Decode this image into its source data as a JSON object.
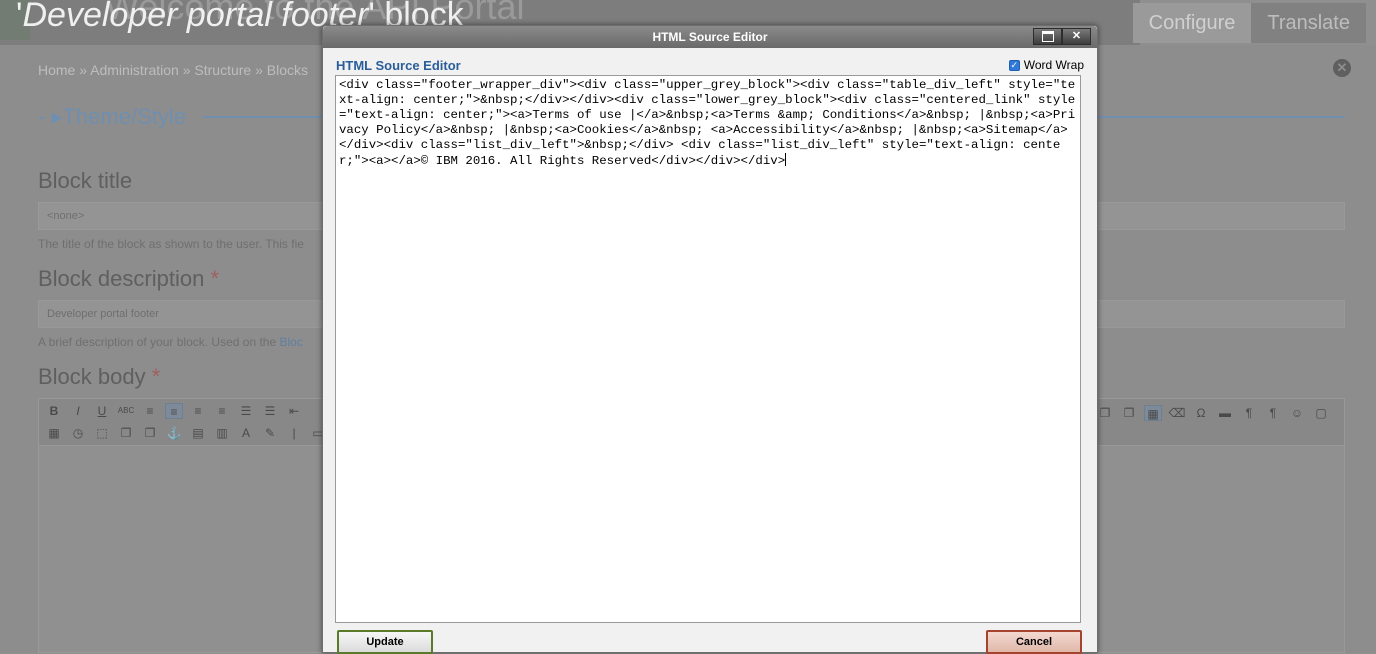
{
  "page": {
    "ghost_title": "Welcome to the API Portal",
    "title_quoted": "Developer portal footer",
    "title_suffix": " block",
    "tabs": [
      "Configure",
      "Translate"
    ],
    "breadcrumb": "Home » Administration » Structure » Blocks",
    "theme_legend": "- ▸Theme/Style",
    "block_title_label": "Block title",
    "block_title_value": "<none>",
    "block_title_help": "The title of the block as shown to the user. This fie",
    "block_desc_label": "Block description",
    "block_desc_value": "Developer portal footer",
    "block_desc_help": "A brief description of your block. Used on the ",
    "block_desc_help_link": "Bloc",
    "block_body_label": "Block body",
    "required_mark": "*"
  },
  "dialog": {
    "title": "HTML Source Editor",
    "heading": "HTML Source Editor",
    "word_wrap_label": "Word Wrap",
    "word_wrap_checked": true,
    "source": "<div class=\"footer_wrapper_div\"><div class=\"upper_grey_block\"><div class=\"table_div_left\" style=\"text-align: center;\">&nbsp;</div></div><div class=\"lower_grey_block\"><div class=\"centered_link\" style=\"text-align: center;\"><a>Terms of use |</a>&nbsp;<a>Terms &amp; Conditions</a>&nbsp; |&nbsp;<a>Privacy Policy</a>&nbsp; |&nbsp;<a>Cookies</a>&nbsp; <a>Accessibility</a>&nbsp; |&nbsp;<a>Sitemap</a></div><div class=\"list_div_left\">&nbsp;</div> <div class=\"list_div_left\" style=\"text-align: center;\"><a></a>© IBM 2016. All Rights Reserved</div></div></div>",
    "update_label": "Update",
    "cancel_label": "Cancel"
  }
}
